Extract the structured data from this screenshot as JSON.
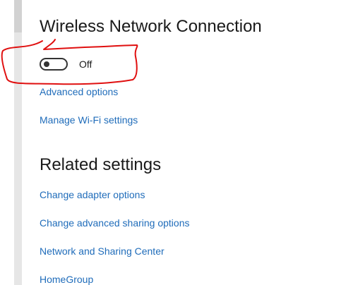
{
  "wireless": {
    "title": "Wireless Network Connection",
    "toggle_state_label": "Off",
    "toggle_on": false,
    "links": {
      "advanced_options": "Advanced options",
      "manage_wifi": "Manage Wi-Fi settings"
    }
  },
  "related": {
    "title": "Related settings",
    "links": {
      "change_adapter": "Change adapter options",
      "change_sharing": "Change advanced sharing options",
      "network_center": "Network and Sharing Center",
      "homegroup": "HomeGroup"
    }
  },
  "colors": {
    "link": "#1f6cba",
    "annotation": "#e01010",
    "text": "#1a1a1a"
  },
  "icons": {
    "toggle": "toggle-switch-off"
  }
}
